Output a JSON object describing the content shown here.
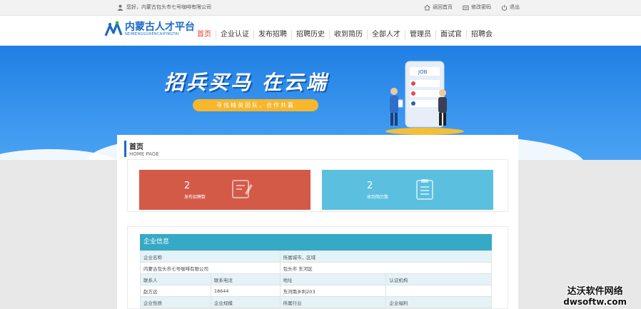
{
  "topbar": {
    "greeting": "您好，内蒙古包头市七号咖啡有限公司",
    "links": [
      {
        "label": "返回首页",
        "icon": "home-icon"
      },
      {
        "label": "修改密码",
        "icon": "password-icon"
      },
      {
        "label": "退出",
        "icon": "power-icon"
      }
    ]
  },
  "logo": {
    "title": "内蒙古人才平台",
    "subtitle": "NEIMENGGURENCAIPINGTAI"
  },
  "nav": {
    "items": [
      "首页",
      "企业认证",
      "发布招聘",
      "招聘历史",
      "收到简历",
      "全部人才",
      "管理员",
      "面试官",
      "招聘会"
    ],
    "active_index": 0
  },
  "banner": {
    "title": "招兵买马  在云端",
    "subtitle": "寻找精英团队，合作共赢",
    "job_label": "JOB"
  },
  "page_header": {
    "title": "首页",
    "subtitle": "HOME PAGE"
  },
  "stats": [
    {
      "count": "2",
      "label": "发布招聘数",
      "color": "#d35a47",
      "icon": "edit-document-icon"
    },
    {
      "count": "2",
      "label": "收到简历数",
      "color": "#5bbfdf",
      "icon": "clipboard-icon"
    }
  ],
  "company_info": {
    "title": "企业信息",
    "rows": [
      {
        "kind": "label",
        "cells": [
          "企业名称",
          "所属城市，区域"
        ]
      },
      {
        "kind": "value",
        "cells": [
          "内蒙古包头市七号咖啡有限公司",
          "包头市 东河区"
        ]
      },
      {
        "kind": "label",
        "cells": [
          "联系人",
          "联系电话",
          "地址",
          "认证机构"
        ]
      },
      {
        "kind": "value",
        "cells": [
          "赵方远",
          "18644",
          "东河南乡利203",
          ""
        ]
      },
      {
        "kind": "label",
        "cells": [
          "企业性质",
          "企业规模",
          "所属行业",
          "企业福利"
        ]
      }
    ]
  },
  "watermark": {
    "line1": "达沃软件网络",
    "line2": "dwsoftw.com"
  }
}
